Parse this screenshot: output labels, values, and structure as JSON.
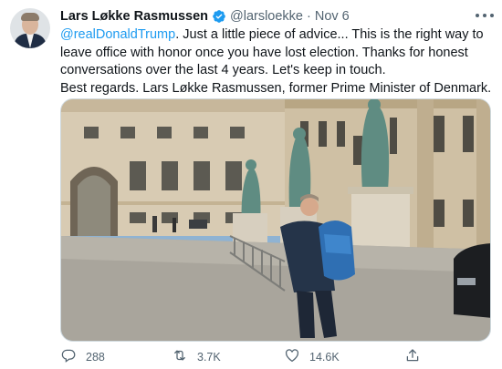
{
  "author": {
    "name": "Lars Løkke Rasmussen",
    "handle": "@larsloekke",
    "separator": "·",
    "date": "Nov 6"
  },
  "tweet": {
    "mention": "@realDonaldTrump",
    "line1_rest": ". Just a little piece of advice... This is the right way to",
    "line2": "leave office with honor once you have lost election. Thanks for honest",
    "line3": "conversations over the last 4 years. Let's keep in touch.",
    "line4": "Best regards. Lars Løkke Rasmussen, former Prime Minister of Denmark."
  },
  "actions": {
    "reply_count": "288",
    "retweet_count": "3.7K",
    "like_count": "14.6K"
  },
  "icons": {
    "verified": "verified-badge-icon",
    "more": "more-icon",
    "reply": "reply-icon",
    "retweet": "retweet-icon",
    "like": "heart-icon",
    "share": "share-icon"
  },
  "colors": {
    "accent": "#1d9bf0",
    "text": "#0f1419",
    "secondary": "#536471"
  }
}
